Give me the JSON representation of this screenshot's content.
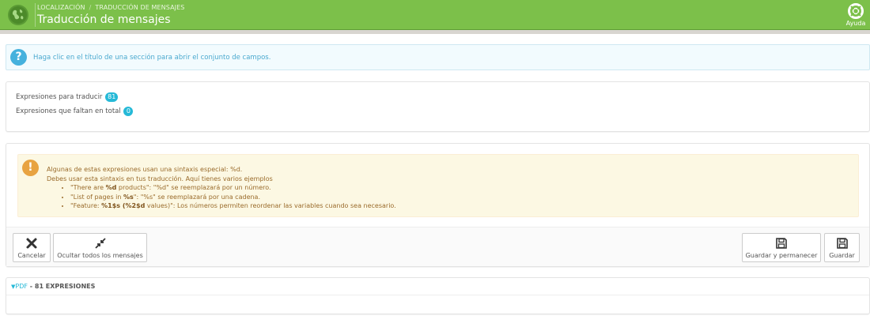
{
  "header": {
    "breadcrumb": [
      "LOCALIZACIÓN",
      "TRADUCCIÓN DE MENSAJES"
    ],
    "breadcrumb_sep": "/",
    "title": "Traducción de mensajes",
    "help_label": "Ayuda"
  },
  "info": {
    "text": "Haga clic en el título de una sección para abrir el conjunto de campos."
  },
  "stats": {
    "to_translate_label": "Expresiones para traducir",
    "to_translate_count": "81",
    "missing_label": "Expresiones que faltan en total",
    "missing_count": "0"
  },
  "warning": {
    "line1": "Algunas de estas expresiones usan una sintaxis especial: %d.",
    "line2": "Debes usar esta sintaxis en tus traducción. Aquí tienes varios ejemplos",
    "ex1_a": "\"There are ",
    "ex1_b": "%d",
    "ex1_c": " products\": \"%d\" se reemplazará por un número.",
    "ex2_a": "\"List of pages in ",
    "ex2_b": "%s",
    "ex2_c": "\": \"%s\" se reemplazará por una cadena.",
    "ex3_a": "\"Feature: ",
    "ex3_b": "%1$s (%2$d",
    "ex3_c": " values)\": Los números permiten reordenar las variables cuando sea necesario."
  },
  "toolbar": {
    "cancel_label": "Cancelar",
    "hide_all_label": "Ocultar todos los mensajes",
    "save_stay_label": "Guardar y permanecer",
    "save_label": "Guardar"
  },
  "section": {
    "name": "PDF",
    "separator": " - ",
    "count_label": "81 EXPRESIONES"
  },
  "colors": {
    "header_bg": "#7cc04a",
    "accent": "#25b9d7",
    "info_icon": "#45b1dd",
    "warning_icon": "#e8a341",
    "warning_bg": "#fcf8e3"
  },
  "icons": {
    "logo": "globe-icon",
    "help": "lifebuoy-icon",
    "info": "question-icon",
    "warning": "exclamation-icon",
    "cancel": "close-icon",
    "hide": "collapse-icon",
    "save": "floppy-disk-icon",
    "caret": "caret-down-icon"
  }
}
